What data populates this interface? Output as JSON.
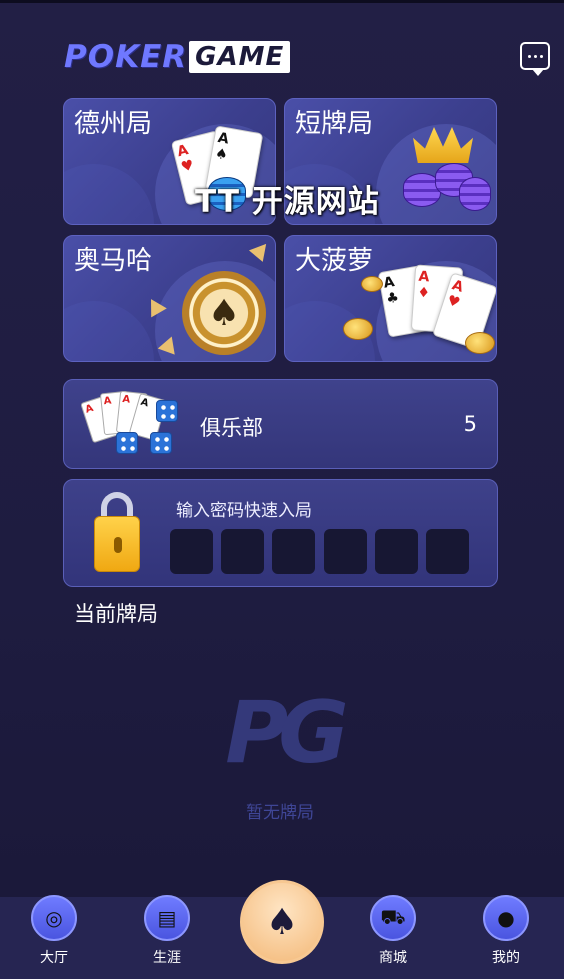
{
  "header": {
    "logo_poker": "POKER",
    "logo_game": "GAME"
  },
  "games": [
    {
      "label": "德州局"
    },
    {
      "label": "短牌局"
    },
    {
      "label": "奥马哈"
    },
    {
      "label": "大菠萝"
    }
  ],
  "watermark": "TT 开源网站",
  "club": {
    "label": "俱乐部",
    "count": "5"
  },
  "password": {
    "title": "输入密码快速入局"
  },
  "current": {
    "title": "当前牌局",
    "empty_text": "暂无牌局",
    "empty_logo": "PG"
  },
  "nav": [
    {
      "label": "大厅",
      "icon": "lobby-icon"
    },
    {
      "label": "生涯",
      "icon": "clipboard-icon"
    },
    {
      "label": "",
      "icon": "spade-icon"
    },
    {
      "label": "商城",
      "icon": "cart-icon"
    },
    {
      "label": "我的",
      "icon": "user-icon"
    }
  ],
  "colors": {
    "background": "#1c1a3a",
    "card": "#4a4fa8",
    "accent": "#6f78ff",
    "center_button": "#f3b877"
  }
}
